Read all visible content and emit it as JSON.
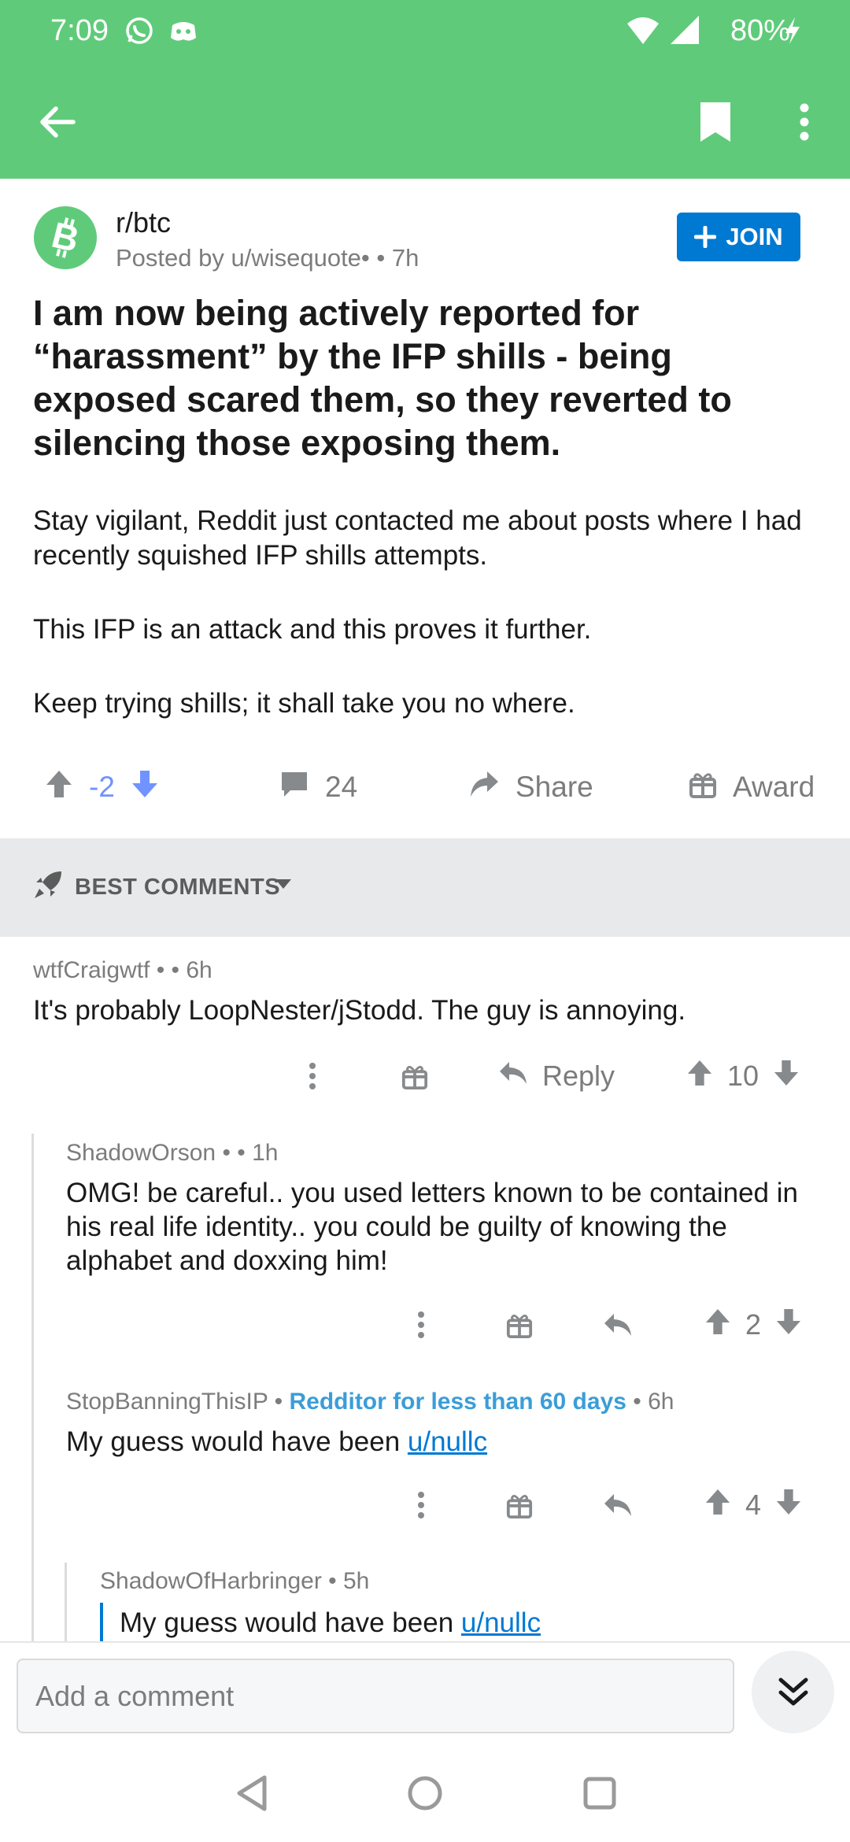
{
  "status_bar": {
    "time": "7:09",
    "battery": "80%",
    "icons": [
      "whatsapp-icon",
      "discord-icon",
      "wifi-icon",
      "signal-icon",
      "charging-icon"
    ]
  },
  "app_bar": {
    "color": "#5fcb7a",
    "icons": [
      "back-arrow-icon",
      "bookmark-icon",
      "more-vert-icon"
    ]
  },
  "post": {
    "subreddit": "r/btc",
    "posted_by": "Posted by u/wisequote•  • 7h",
    "join_label": "JOIN",
    "title": "I am now being actively reported for “harassment” by the IFP shills - being exposed scared them, so they reverted to silencing those exposing them.",
    "body": [
      "Stay vigilant, Reddit just contacted me about posts where I had recently squished IFP shills attempts.",
      "This IFP is an attack and this proves it further.",
      "Keep trying shills; it shall take you no where."
    ],
    "score": "-2",
    "comments_count": "24",
    "share_label": "Share",
    "award_label": "Award"
  },
  "sort": {
    "label": "BEST COMMENTS"
  },
  "comments": [
    {
      "author": "wtfCraigwtf",
      "meta": " •  • 6h",
      "text": "It's probably LoopNester/jStodd. The guy is annoying.",
      "reply_label": "Reply",
      "score": "10"
    },
    {
      "author": "ShadowOrson",
      "meta": " •  • 1h",
      "text": "OMG! be careful.. you used letters known to be contained in his real life identity.. you could be guilty of knowing the alphabet and doxxing him!",
      "score": "2"
    },
    {
      "author": "StopBanningThisIP",
      "flair": "Redditor for less than 60 days",
      "meta": " • 6h",
      "text_prefix": "My guess would have been ",
      "link": "u/nullc",
      "score": "4"
    },
    {
      "author": "ShadowOfHarbringer",
      "meta": " • 5h",
      "text_prefix": "My guess would have been ",
      "link": "u/nullc"
    }
  ],
  "composer": {
    "placeholder": "Add a comment"
  },
  "nav": {
    "icons": [
      "nav-back-icon",
      "nav-home-icon",
      "nav-recents-icon"
    ]
  }
}
